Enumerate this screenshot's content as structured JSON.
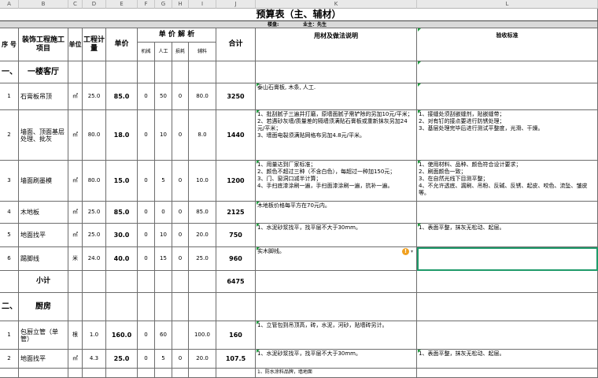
{
  "column_letters": [
    "A",
    "B",
    "C",
    "D",
    "E",
    "F",
    "G",
    "H",
    "I",
    "J",
    "K",
    "L"
  ],
  "title": "预算表（主、辅材）",
  "subtitle": {
    "property_label": "楼盘:",
    "owner_label": "业主：先生"
  },
  "headers": {
    "seq": "序 号",
    "item": "装饰工程施工项目",
    "unit": "单位",
    "qty": "工程计量",
    "price": "单价",
    "analysis": "单 价 解 析",
    "mech": "机械",
    "labor": "人工",
    "loss": "损耗",
    "aux": "辅料",
    "total": "合计",
    "desc": "用材及做法说明",
    "accept": "验收标准"
  },
  "sections": {
    "s1": {
      "num": "一、",
      "name": "一楼客厅"
    },
    "s2": {
      "num": "二、",
      "name": "厨房"
    }
  },
  "subtotal": {
    "label": "小计",
    "total": "6475"
  },
  "warn_icon": "warning-icon",
  "rows": [
    {
      "no": "1",
      "item": "石膏板吊顶",
      "unit": "㎡",
      "qty": "25.0",
      "price": "85.0",
      "mech": "0",
      "labor": "50",
      "loss": "0",
      "aux": "80.0",
      "total": "3250",
      "desc": "泰山石膏板, 木条, 人工.",
      "accept": ""
    },
    {
      "no": "2",
      "item": "墙面、顶面基层处理、批灰",
      "unit": "㎡",
      "qty": "80.0",
      "price": "18.0",
      "mech": "0",
      "labor": "10",
      "loss": "0",
      "aux": "8.0",
      "total": "1440",
      "desc": "1、批刮腻子三遍并打磨，原墙面腻子需铲除的另加10元/平米；\n2、若遇砂灰墙/质量差的隔墙须满贴石膏板或重新抹灰另加24元/平米；\n3、墙面电裂须满贴网格布另加4.8元/平米。",
      "accept": "1、接缝处须刮嵌缝剂，贴嵌缝带；\n2、对有钉的接点要进行防锈处理；\n3、基层处理完毕后进行测试平整度，光滑、干燥。"
    },
    {
      "no": "3",
      "item": "墙面刷墨模",
      "unit": "㎡",
      "qty": "80.0",
      "price": "15.0",
      "mech": "0",
      "labor": "5",
      "loss": "0",
      "aux": "10.0",
      "total": "1200",
      "desc": "1、用量达到厂家标准；\n2、颜色不超过三种（不含白色），每超过一种加150元；\n3、门、窗洞口减半计算；\n4、手扫底漆涂刷一遍，手扫面漆涂刷一遍，抗补一遍。",
      "accept": "1、使用材料、品种、颜色符合设计要求；\n2、刷面颜色一致；\n3、在自然光线下目测平整；\n4、不允许透底、漏刷、吊粉、反碱、反锈、起皮、咬色、流坠、皱皮等。"
    },
    {
      "no": "4",
      "item": "木地板",
      "unit": "㎡",
      "qty": "25.0",
      "price": "85.0",
      "mech": "0",
      "labor": "0",
      "loss": "0",
      "aux": "85.0",
      "total": "2125",
      "desc": "木地板价格每平方在70元内。",
      "accept": ""
    },
    {
      "no": "5",
      "item": "地面找平",
      "unit": "㎡",
      "qty": "25.0",
      "price": "30.0",
      "mech": "0",
      "labor": "10",
      "loss": "0",
      "aux": "20.0",
      "total": "750",
      "desc": "1、水泥砂浆找平，找平层不大于30mm。",
      "accept": "1、表面平整，抹灰无松动、起层。"
    },
    {
      "no": "6",
      "item": "踢脚线",
      "unit": "米",
      "qty": "24.0",
      "price": "40.0",
      "mech": "0",
      "labor": "15",
      "loss": "0",
      "aux": "25.0",
      "total": "960",
      "desc": "实木脚线。",
      "accept": ""
    },
    {
      "no": "1",
      "item": "包厨立管（单管）",
      "unit": "根",
      "qty": "1.0",
      "price": "160.0",
      "mech": "0",
      "labor": "60",
      "loss": "",
      "aux": "100.0",
      "total": "160",
      "desc": "1、立管包到吊顶高，砖，水泥，河砂，贴墙砖另计。",
      "accept": ""
    },
    {
      "no": "2",
      "item": "地面找平",
      "unit": "㎡",
      "qty": "4.3",
      "price": "25.0",
      "mech": "0",
      "labor": "5",
      "loss": "0",
      "aux": "20.0",
      "total": "107.5",
      "desc": "1、水泥砂浆找平，找平层不大于30mm。",
      "accept": "1、表面平整，抹灰无松动、起层。"
    }
  ],
  "next_row_hint": "1、防水涂料品牌，墙地面"
}
